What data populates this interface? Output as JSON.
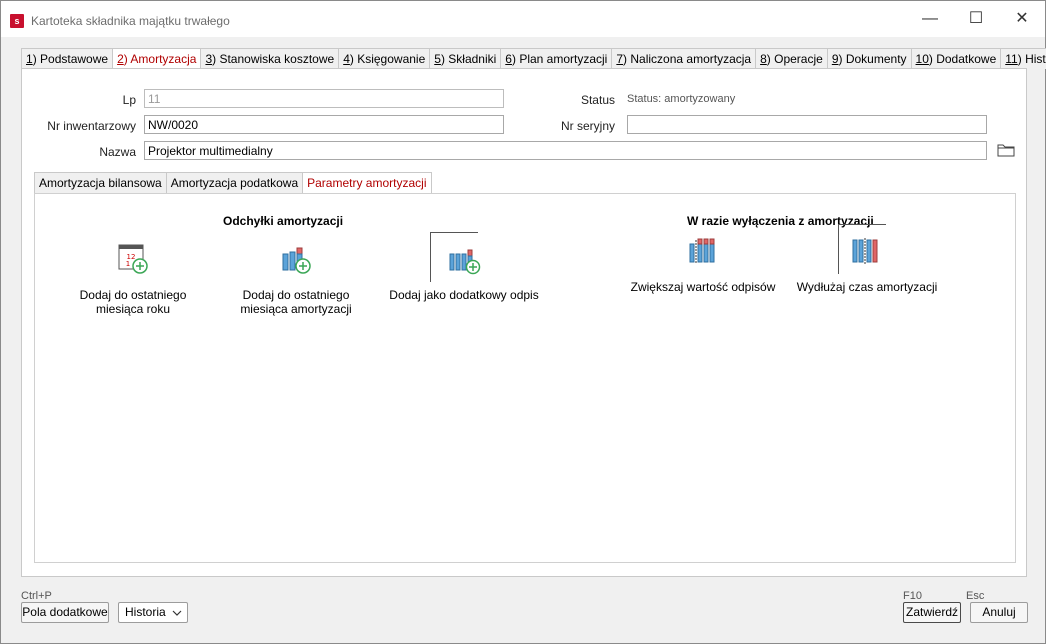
{
  "window": {
    "title": "Kartoteka składnika majątku trwałego",
    "app_icon_letter": "s",
    "minimize": "—",
    "maximize": "☐",
    "close": "✕"
  },
  "tabs": [
    {
      "key": "1",
      "label": ") Podstawowe"
    },
    {
      "key": "2",
      "label": ") Amortyzacja"
    },
    {
      "key": "3",
      "label": ") Stanowiska kosztowe"
    },
    {
      "key": "4",
      "label": ") Księgowanie"
    },
    {
      "key": "5",
      "label": ") Składniki"
    },
    {
      "key": "6",
      "label": ") Plan amortyzacji"
    },
    {
      "key": "7",
      "label": ") Naliczona amortyzacja"
    },
    {
      "key": "8",
      "label": ") Operacje"
    },
    {
      "key": "9",
      "label": ") Dokumenty"
    },
    {
      "key": "10",
      "label": ") Dodatkowe"
    },
    {
      "key": "11",
      "label": ") Historia"
    }
  ],
  "form": {
    "lp_label": "Lp",
    "lp_value": "11",
    "nr_inw_label": "Nr inwentarzowy",
    "nr_inw_value": "NW/0020",
    "nazwa_label": "Nazwa",
    "nazwa_value": "Projektor multimedialny",
    "status_label": "Status",
    "status_value": "Status: amortyzowany",
    "nr_seryjny_label": "Nr seryjny",
    "nr_seryjny_value": ""
  },
  "subtabs": [
    "Amortyzacja bilansowa",
    "Amortyzacja podatkowa",
    "Parametry amortyzacji"
  ],
  "params": {
    "left_header": "Odchyłki amortyzacji",
    "right_header": "W razie wyłączenia z amortyzacji",
    "actions": {
      "add_last_month_year": "Dodaj do ostatniego miesiąca roku",
      "add_last_month_amort": "Dodaj do ostatniego miesiąca amortyzacji",
      "add_extra": "Dodaj jako dodatkowy odpis",
      "increase_value": "Zwiększaj wartość odpisów",
      "extend_time": "Wydłużaj czas amortyzacji"
    }
  },
  "footer": {
    "ctrl_p": "Ctrl+P",
    "pola_dodatkowe": "Pola dodatkowe",
    "historia": "Historia",
    "f10": "F10",
    "esc": "Esc",
    "zatwierdz": "Zatwierdź",
    "anuluj": "Anuluj"
  },
  "colors": {
    "accent": "#b00000",
    "icon_blue": "#5ba3d9",
    "icon_red": "#e06666",
    "icon_green": "#3aa655"
  }
}
